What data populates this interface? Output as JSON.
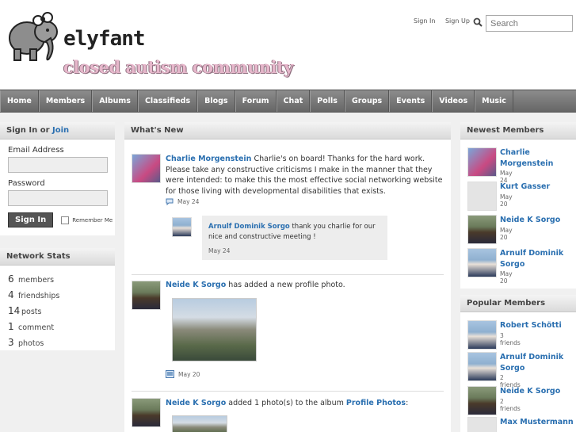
{
  "site": {
    "name": "elyfant",
    "tagline": "closed autism community"
  },
  "top_links": {
    "signin": "Sign In",
    "signup": "Sign Up"
  },
  "search": {
    "placeholder": "Search"
  },
  "nav": [
    "Home",
    "Members",
    "Albums",
    "Classifieds",
    "Blogs",
    "Forum",
    "Chat",
    "Polls",
    "Groups",
    "Events",
    "Videos",
    "Music"
  ],
  "signin_panel": {
    "title_prefix": "Sign In or ",
    "title_link": "Join",
    "email_label": "Email Address",
    "password_label": "Password",
    "button": "Sign In",
    "remember": "Remember Me"
  },
  "stats_panel": {
    "title": "Network Stats",
    "items": [
      {
        "n": "6",
        "label": "members"
      },
      {
        "n": "4",
        "label": "friendships"
      },
      {
        "n": "14",
        "label": "posts"
      },
      {
        "n": "1",
        "label": "comment"
      },
      {
        "n": "3",
        "label": "photos"
      }
    ]
  },
  "feed": {
    "title": "What's New",
    "post1": {
      "author": "Charlie Morgenstein",
      "text": "Charlie's on board!  Thanks for the hard work.  Please take any constructive criticisms I make in the manner that they were intended: to make this the most effective social networking website for those living with developmental disabilities that exists.",
      "date": "May 24"
    },
    "reply1": {
      "author": "Arnulf Dominik Sorgo",
      "text": "thank you charlie for our nice and constructive meeting !",
      "date": "May 24"
    },
    "post2": {
      "author": "Neide K Sorgo",
      "text": "has added a new profile photo.",
      "date": "May 20"
    },
    "post3": {
      "author": "Neide K Sorgo",
      "text": "added 1 photo(s) to the album",
      "album": "Profile Photos",
      "suffix": ":"
    }
  },
  "newest": {
    "title": "Newest Members",
    "members": [
      {
        "name": "Charlie Morgenstein",
        "sub": "May 24"
      },
      {
        "name": "Kurt Gasser",
        "sub": "May 20"
      },
      {
        "name": "Neide K Sorgo",
        "sub": "May 20"
      },
      {
        "name": "Arnulf Dominik Sorgo",
        "sub": "May 20"
      }
    ]
  },
  "popular": {
    "title": "Popular Members",
    "members": [
      {
        "name": "Robert Schötti",
        "sub": "3 friends"
      },
      {
        "name": "Arnulf Dominik Sorgo",
        "sub": "2 friends"
      },
      {
        "name": "Neide K Sorgo",
        "sub": "2 friends"
      },
      {
        "name": "Max Mustermann",
        "sub": ""
      }
    ]
  }
}
